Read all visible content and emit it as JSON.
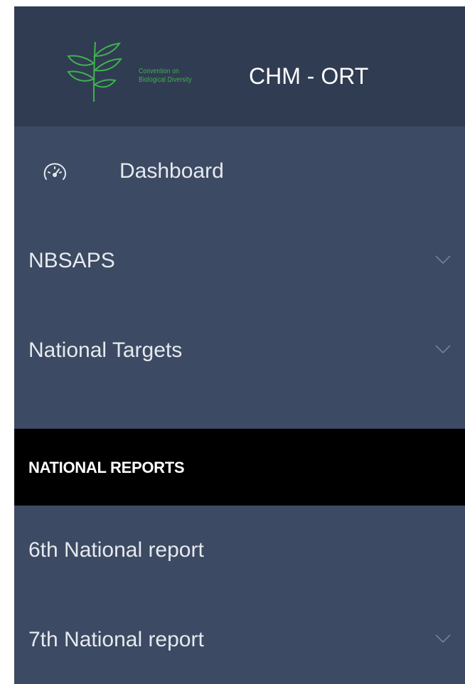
{
  "brand": {
    "org_line1": "Convention on",
    "org_line2": "Biological Diversity",
    "title": "CHM - ORT",
    "logo_icon": "cbd-leaf-logo",
    "logo_color": "#3fb34f"
  },
  "nav": {
    "dashboard": {
      "label": "Dashboard",
      "icon": "speedometer-icon"
    },
    "nbsaps": {
      "label": "NBSAPS",
      "icon": "chevron-down-icon"
    },
    "national_targets": {
      "label": "National Targets",
      "icon": "chevron-down-icon"
    }
  },
  "section": {
    "national_reports": "NATIONAL REPORTS"
  },
  "reports": {
    "sixth": {
      "label": "6th National report"
    },
    "seventh": {
      "label": "7th National report",
      "icon": "chevron-down-icon"
    }
  },
  "colors": {
    "sidebar_bg": "#3c4a63",
    "brand_bg": "#303c52",
    "section_bg": "#000000",
    "text": "#e6e9ee",
    "accent_green": "#3fb34f"
  }
}
